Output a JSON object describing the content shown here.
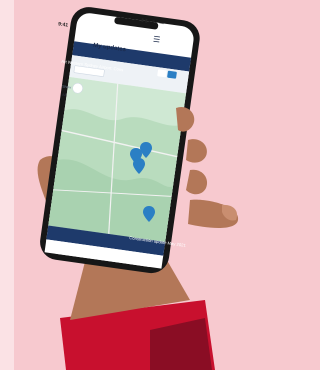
{
  "status_bar": {
    "time": "9:41",
    "icons": "▮▮ ▼ ▭"
  },
  "app": {
    "title": "My updates",
    "menu_icon": "hamburger-menu-icon"
  },
  "banner": {
    "text": "Art Western Sydney Airport: Cons"
  },
  "filter": {
    "label": "Show",
    "value": "All"
  },
  "map": {
    "marker_count": 4,
    "marker_color": "#2b7fc4"
  },
  "footer": {
    "text": "Construction update May 2021"
  },
  "colors": {
    "background": "#f7c9cf",
    "navy": "#1e3a6b",
    "skin": "#b37758",
    "sleeve": "#c8102e"
  }
}
